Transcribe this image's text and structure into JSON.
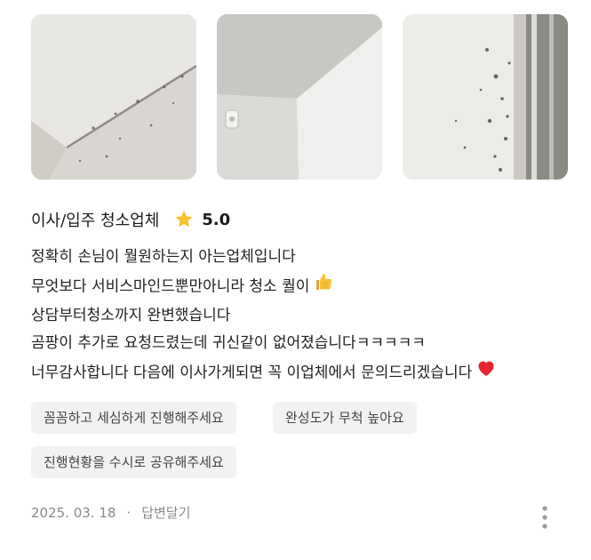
{
  "review": {
    "category": "이사/입주 청소업체",
    "rating": "5.0",
    "lines": [
      "정확히 손님이 뭘원하는지 아는업체입니다",
      "무엇보다 서비스마인드뿐만아니라 청소 퀄이",
      "상담부터청소까지 완변했습니다",
      "곰팡이 추가로 요청드렸는데 귀신같이 없어졌습니다ㅋㅋㅋㅋㅋ",
      "너무감사합니다 다음에 이사가게되면 꼭 이업체에서 문의드리겠습니다"
    ],
    "tags": [
      "꼼꼼하고 세심하게 진행해주세요",
      "완성도가 무척 높아요",
      "진행현황을 수시로 공유해주세요"
    ],
    "date": "2025. 03. 18",
    "separator": "·",
    "reply_label": "답변달기"
  },
  "icons": {
    "star": "star-icon",
    "thumbs_up": "thumbs-up-icon",
    "heart": "heart-icon",
    "more": "more-vertical-icon"
  },
  "colors": {
    "star": "#f7c233",
    "heart": "#e8242f",
    "tag_bg": "#f1f2f4",
    "meta_text": "#8a8a8a"
  }
}
